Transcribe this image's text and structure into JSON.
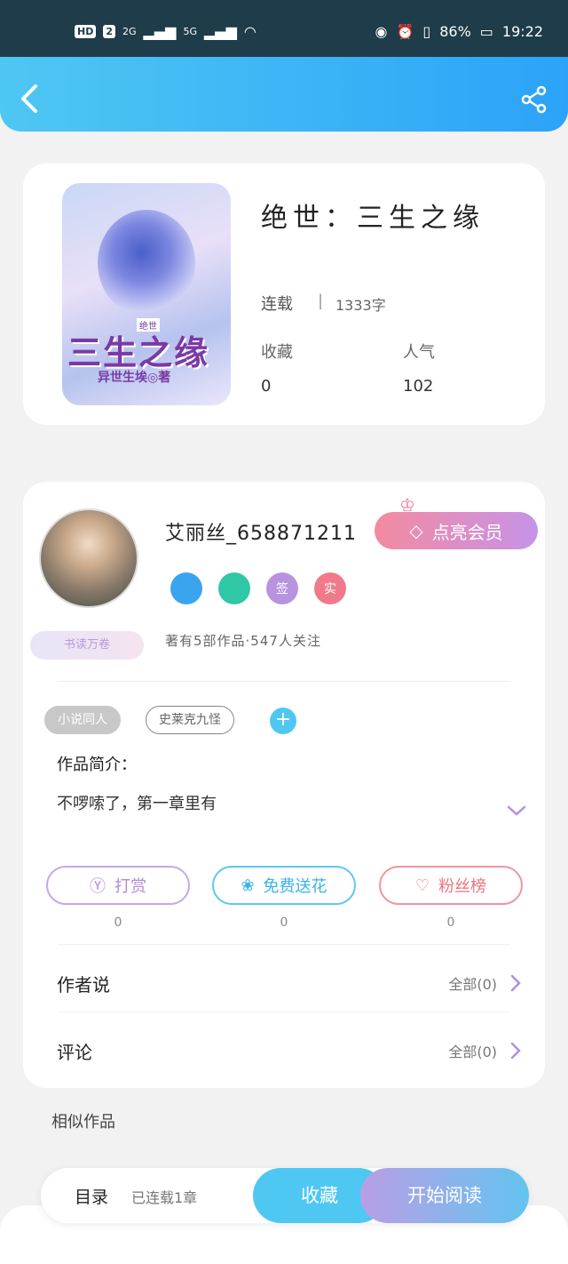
{
  "status_bar": {
    "hd": "HD",
    "sim": "2",
    "sig1": "2G",
    "sig2": "5G",
    "battery": "86%",
    "time": "19:22"
  },
  "header": {
    "back_icon": "chevron-left-icon",
    "share_icon": "share-icon"
  },
  "book": {
    "title": "绝世：三生之缘",
    "cover_title": "三生之缘",
    "cover_tag": "绝世",
    "cover_author": "异世生埃◎著",
    "status": "连载",
    "separator": "|",
    "word_count": "1333字",
    "stats": [
      {
        "label": "收藏",
        "value": "0"
      },
      {
        "label": "人气",
        "value": "102"
      }
    ]
  },
  "author": {
    "username": "艾丽丝_658871211",
    "vip_button": "点亮会员",
    "rank_badge": "书读万卷",
    "medals": [
      "",
      "",
      "签",
      "实"
    ],
    "works_info": "著有5部作品·547人关注",
    "tags": [
      "小说同人",
      "史莱克九怪"
    ],
    "add_tag": "+",
    "intro_label": "作品简介：",
    "intro_text": "不啰嗦了，第一章里有"
  },
  "actions": [
    {
      "label": "打赏",
      "count": "0",
      "icon": "yen-icon"
    },
    {
      "label": "免费送花",
      "count": "0",
      "icon": "flower-icon"
    },
    {
      "label": "粉丝榜",
      "count": "0",
      "icon": "user-heart-icon"
    }
  ],
  "rows": [
    {
      "label": "作者说",
      "value": "全部(0)"
    },
    {
      "label": "评论",
      "value": "全部(0)"
    }
  ],
  "similar": "相似作品",
  "bottom_bar": {
    "toc": "目录",
    "chapters": "已连载1章",
    "collect": "收藏",
    "read": "开始阅读"
  },
  "colors": {
    "header": "#2ca3f8",
    "accent_blue": "#4fc7f3",
    "accent_purple": "#b99ee6",
    "vip_pink": "#f48aa0"
  }
}
